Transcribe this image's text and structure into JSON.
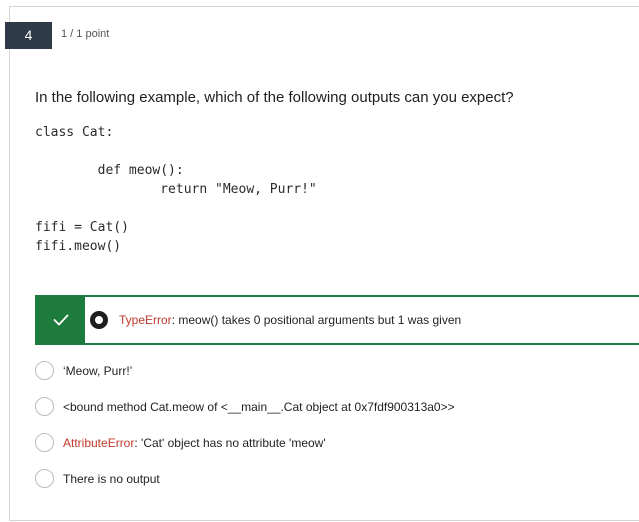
{
  "question": {
    "number": "4",
    "points": "1 / 1 point",
    "prompt": "In the following example, which of the following outputs can you expect?",
    "code_lines": [
      "class Cat:",
      "        def meow():",
      "                return \"Meow, Purr!\"",
      "fifi = Cat()",
      "fifi.meow()"
    ]
  },
  "selected_option": {
    "error_prefix": "TypeError",
    "rest": ": meow() takes 0 positional arguments but 1 was given",
    "status": "correct"
  },
  "options": [
    {
      "text": "‘Meow, Purr!’"
    },
    {
      "text": "<bound method Cat.meow of <__main__.Cat object at 0x7fdf900313a0>>"
    },
    {
      "error_prefix": "AttributeError",
      "rest": ": 'Cat' object has no attribute 'meow'"
    },
    {
      "text": "There is no output"
    }
  ],
  "colors": {
    "correct": "#1e7b3e",
    "error_text": "#c0392b",
    "question_badge": "#2e3a47"
  },
  "icons": {
    "check": "checkmark-icon"
  }
}
